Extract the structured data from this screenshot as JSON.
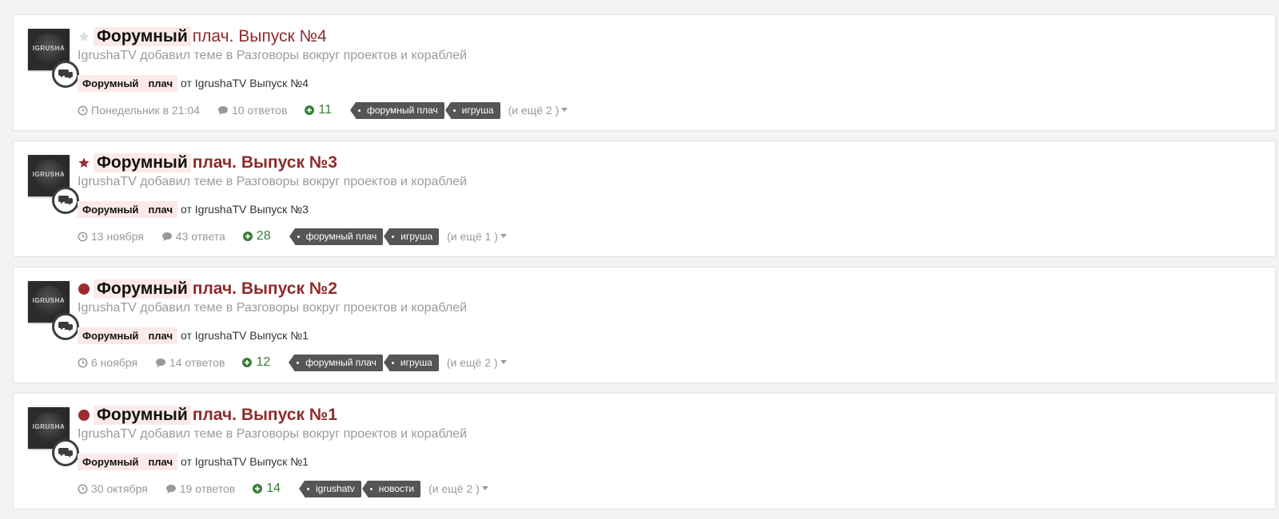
{
  "topics": [
    {
      "marker": "star-empty",
      "title_highlight": "Форумный",
      "title_rest": "плач. Выпуск №4",
      "title_bold": false,
      "meta": "IgrushaTV добавил теме в Разговоры вокруг проектов и кораблей",
      "snippet_word1": "Форумный",
      "snippet_word2": "плач",
      "snippet_rest": "от IgrushaTV Выпуск №4",
      "date": "Понедельник в 21:04",
      "replies": "10 ответов",
      "reputation": "11",
      "tags": [
        "форумный плач",
        "игруша"
      ],
      "more": "(и ещё 2 )"
    },
    {
      "marker": "star-filled",
      "title_highlight": "Форумный",
      "title_rest": "плач. Выпуск №3",
      "title_bold": true,
      "meta": "IgrushaTV добавил теме в Разговоры вокруг проектов и кораблей",
      "snippet_word1": "Форумный",
      "snippet_word2": "плач",
      "snippet_rest": "от IgrushaTV Выпуск №3",
      "date": "13 ноября",
      "replies": "43 ответа",
      "reputation": "28",
      "tags": [
        "форумный плач",
        "игруша"
      ],
      "more": "(и ещё 1 )"
    },
    {
      "marker": "dot",
      "title_highlight": "Форумный",
      "title_rest": "плач. Выпуск №2",
      "title_bold": true,
      "meta": "IgrushaTV добавил теме в Разговоры вокруг проектов и кораблей",
      "snippet_word1": "Форумный",
      "snippet_word2": "плач",
      "snippet_rest": "от IgrushaTV Выпуск №1",
      "date": "6 ноября",
      "replies": "14 ответов",
      "reputation": "12",
      "tags": [
        "форумный плач",
        "игруша"
      ],
      "more": "(и ещё 2 )"
    },
    {
      "marker": "dot",
      "title_highlight": "Форумный",
      "title_rest": "плач. Выпуск №1",
      "title_bold": true,
      "meta": "IgrushaTV добавил теме в Разговоры вокруг проектов и кораблей",
      "snippet_word1": "Форумный",
      "snippet_word2": "плач",
      "snippet_rest": "от IgrushaTV Выпуск №1",
      "date": "30 октября",
      "replies": "19 ответов",
      "reputation": "14",
      "tags": [
        "igrushatv",
        "новости"
      ],
      "more": "(и ещё 2 )"
    }
  ],
  "avatar_text": "IGRUSHA",
  "colors": {
    "title_red": "#8e2b2b",
    "highlight_bg": "#fde9e9",
    "tag_bg": "#555555",
    "rep_green": "#3b7d3b",
    "muted": "#999999"
  }
}
